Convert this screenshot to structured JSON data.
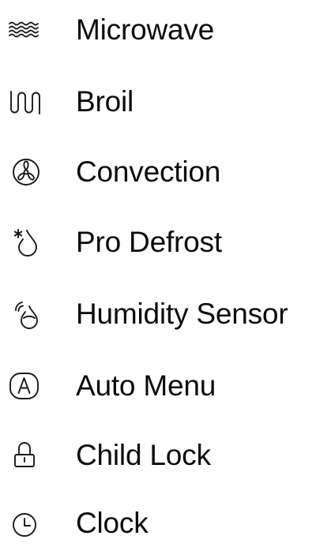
{
  "features": [
    {
      "label": "Microwave",
      "icon": "microwave-waves-icon"
    },
    {
      "label": "Broil",
      "icon": "broil-coil-icon"
    },
    {
      "label": "Convection",
      "icon": "convection-fan-icon"
    },
    {
      "label": "Pro Defrost",
      "icon": "defrost-snowflake-drop-icon"
    },
    {
      "label": "Humidity Sensor",
      "icon": "humidity-sensor-icon"
    },
    {
      "label": "Auto Menu",
      "icon": "auto-menu-icon"
    },
    {
      "label": "Child Lock",
      "icon": "child-lock-icon"
    },
    {
      "label": "Clock",
      "icon": "clock-icon"
    }
  ]
}
